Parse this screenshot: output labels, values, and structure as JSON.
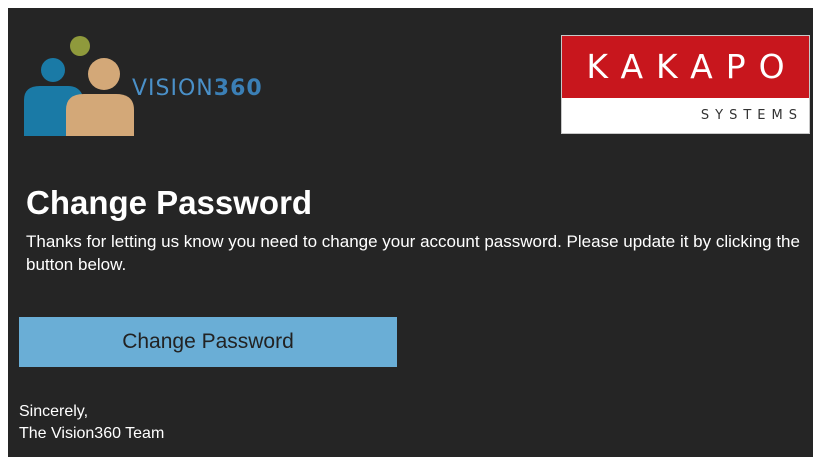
{
  "brand": {
    "vision_prefix": "VISION",
    "vision_number": "360",
    "kakapo_name": "KAKAPO",
    "kakapo_tagline": "SYSTEMS"
  },
  "colors": {
    "background": "#252525",
    "button": "#6aaed6",
    "vision_blue": "#4a90c8",
    "kakapo_red": "#c8161d",
    "figure_olive": "#8f9a3c",
    "figure_teal": "#1a7aa6",
    "figure_tan": "#d3a878"
  },
  "email": {
    "title": "Change Password",
    "body": "Thanks for letting us know you need to change your account password. Please update it by clicking the button below.",
    "button_label": "Change Password",
    "signoff_line1": "Sincerely,",
    "signoff_line2": "The Vision360 Team"
  }
}
